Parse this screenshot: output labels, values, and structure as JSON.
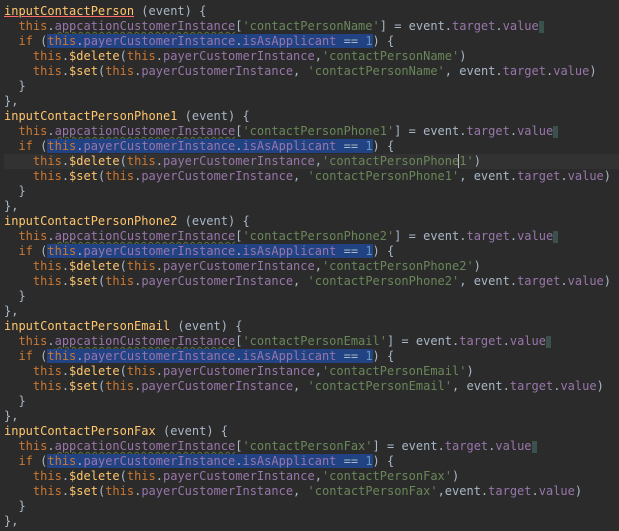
{
  "methods": [
    {
      "name": "inputContactPerson",
      "param": "event",
      "appKey": "contactPersonName",
      "delKey": "contactPersonName",
      "setKey": "contactPersonName",
      "setQuoted": true,
      "delQuoted": true,
      "cursor": false,
      "spaceBeforeEvent": true,
      "firstNameUnderline": true,
      "lineHi": false
    },
    {
      "name": "inputContactPersonPhone1",
      "param": "event",
      "appKey": "contactPersonPhone1",
      "delKey": "contactPersonPhone1",
      "setKey": "contactPersonPhone1",
      "setQuoted": true,
      "delQuoted": true,
      "cursor": true,
      "spaceBeforeEvent": true,
      "firstNameUnderline": false,
      "lineHi": true
    },
    {
      "name": "inputContactPersonPhone2",
      "param": "event",
      "appKey": "contactPersonPhone2",
      "delKey": "contactPersonPhone2",
      "setKey": "contactPersonPhone2",
      "setQuoted": true,
      "delQuoted": true,
      "cursor": false,
      "spaceBeforeEvent": true,
      "firstNameUnderline": false,
      "lineHi": false
    },
    {
      "name": "inputContactPersonEmail",
      "param": "event",
      "appKey": "contactPersonEmail",
      "delKey": "contactPersonEmail",
      "setKey": "contactPersonEmail",
      "setQuoted": true,
      "delQuoted": true,
      "cursor": false,
      "spaceBeforeEvent": true,
      "firstNameUnderline": false,
      "lineHi": false
    },
    {
      "name": "inputContactPersonFax",
      "param": "event",
      "appKey": "contactPersonFax",
      "delKey": "contactPersonFax",
      "setKey": "contactPersonFax",
      "setQuoted": true,
      "delQuoted": true,
      "cursor": false,
      "spaceBeforeEvent": false,
      "firstNameUnderline": false,
      "lineHi": false
    }
  ],
  "tokens": {
    "if": "if",
    "this": "this",
    "delete": "$delete",
    "set": "$set",
    "app": "appcationCustomerInstance",
    "payer": "payerCustomerInstance",
    "isAs": "isAsApplicant",
    "eq": "==",
    "one": "1",
    "event": "event",
    "target": "target",
    "value": "value"
  }
}
